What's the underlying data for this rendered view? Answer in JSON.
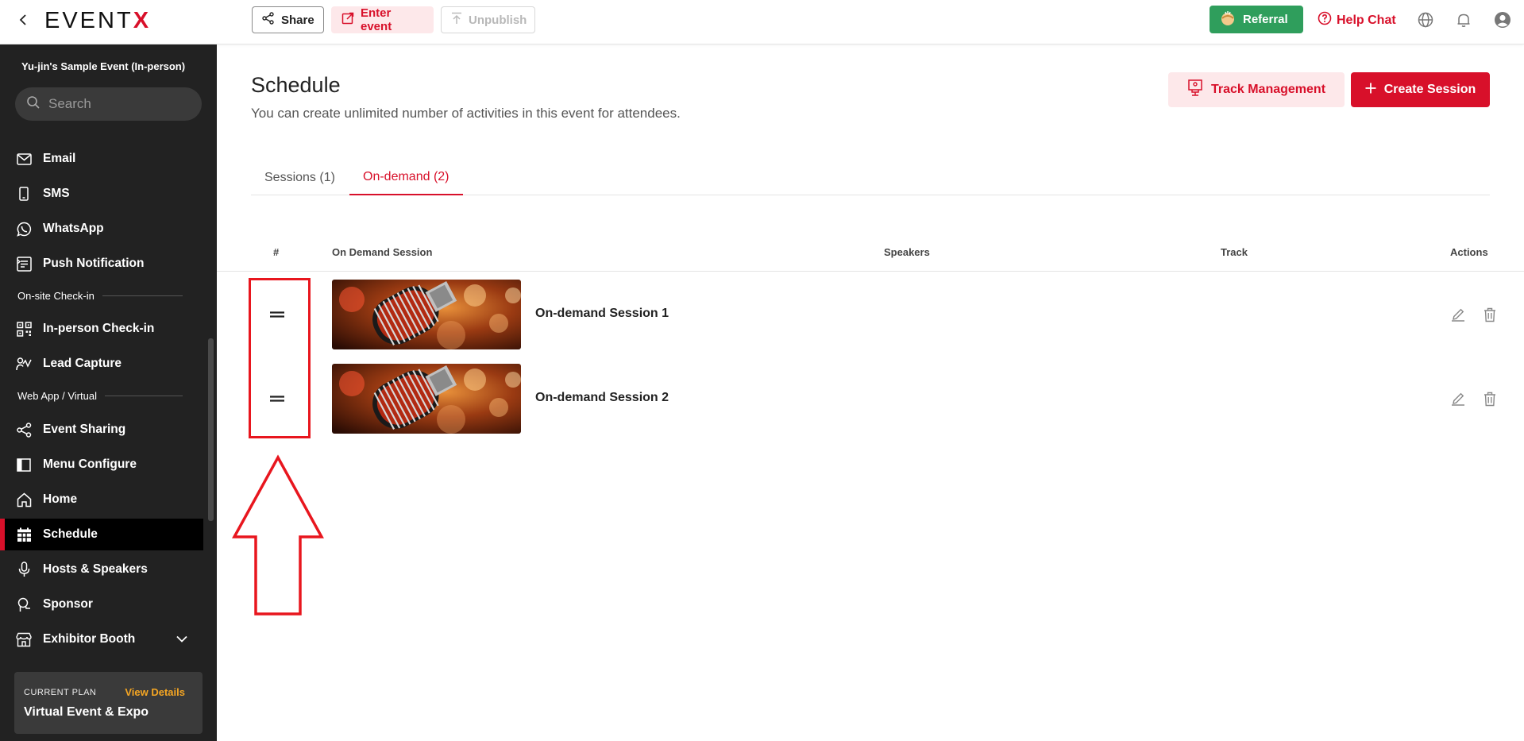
{
  "brand": {
    "logo_text": "EVENT",
    "logo_accent": "X",
    "accent_color": "#d8102a"
  },
  "topbar": {
    "share_label": "Share",
    "enter_event_label": "Enter event",
    "unpublish_label": "Unpublish",
    "referral_label": "Referral",
    "help_chat_label": "Help Chat"
  },
  "sidebar": {
    "event_name": "Yu-jin's Sample Event (In-person)",
    "search_placeholder": "Search",
    "items_top": [
      {
        "label": "Email",
        "icon": "mail-icon"
      },
      {
        "label": "SMS",
        "icon": "phone-icon"
      },
      {
        "label": "WhatsApp",
        "icon": "whatsapp-icon"
      },
      {
        "label": "Push Notification",
        "icon": "push-notification-icon"
      }
    ],
    "section_onsite": "On-site Check-in",
    "items_onsite": [
      {
        "label": "In-person Check-in",
        "icon": "qr-code-icon"
      },
      {
        "label": "Lead Capture",
        "icon": "lead-capture-icon"
      }
    ],
    "section_web": "Web App / Virtual",
    "items_web": [
      {
        "label": "Event Sharing",
        "icon": "share-icon"
      },
      {
        "label": "Menu Configure",
        "icon": "layout-icon"
      },
      {
        "label": "Home",
        "icon": "home-icon"
      },
      {
        "label": "Schedule",
        "icon": "calendar-icon"
      },
      {
        "label": "Hosts & Speakers",
        "icon": "microphone-icon"
      },
      {
        "label": "Sponsor",
        "icon": "sponsor-icon"
      },
      {
        "label": "Exhibitor Booth",
        "icon": "store-icon"
      }
    ],
    "active_item": "Schedule",
    "plan": {
      "label": "CURRENT PLAN",
      "link": "View Details",
      "name": "Virtual Event & Expo"
    }
  },
  "main": {
    "title": "Schedule",
    "subtitle": "You can create unlimited number of activities in this event for attendees.",
    "track_button": "Track Management",
    "create_button": "Create Session",
    "tabs": [
      {
        "label": "Sessions (1)",
        "active": false
      },
      {
        "label": "On-demand (2)",
        "active": true
      }
    ],
    "table": {
      "headers": {
        "index": "#",
        "session": "On Demand Session",
        "speakers": "Speakers",
        "track": "Track",
        "actions": "Actions"
      },
      "rows": [
        {
          "title": "On-demand Session 1",
          "speakers": "",
          "track": ""
        },
        {
          "title": "On-demand Session 2",
          "speakers": "",
          "track": ""
        }
      ]
    }
  }
}
